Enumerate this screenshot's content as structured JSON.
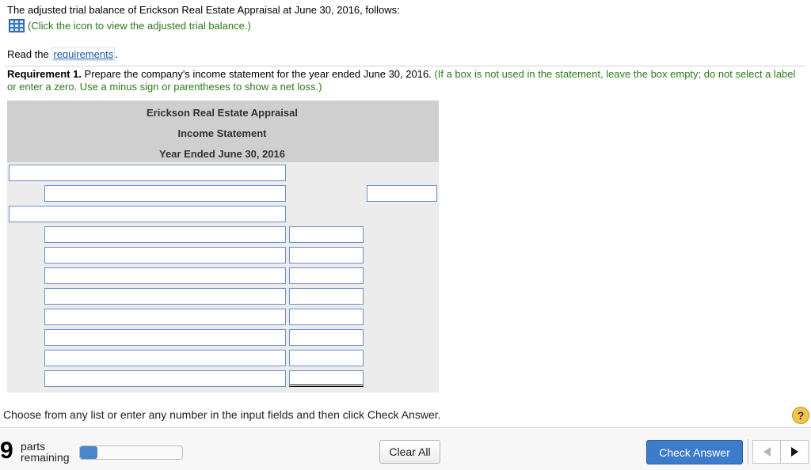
{
  "intro": "The adjusted trial balance of Erickson Real Estate Appraisal at June 30, 2016, follows:",
  "icon_link": "(Click the icon to view the adjusted trial balance.)",
  "read_prefix": "Read the ",
  "requirements_link": "requirements",
  "read_suffix": ".",
  "requirement": {
    "label": "Requirement 1.",
    "text": " Prepare the company's income statement for the year ended June 30, 2016. ",
    "instruction": "(If a box is not used in the statement, leave the box empty; do not select a label or enter a zero. Use a minus sign or parentheses to show a net loss.)"
  },
  "statement": {
    "company": "Erickson Real Estate Appraisal",
    "title": "Income Statement",
    "period": "Year Ended June 30, 2016"
  },
  "choose_text": "Choose from any list or enter any number in the input fields and then click Check Answer.",
  "help": "?",
  "footer": {
    "parts_count": "9",
    "parts_line1": "parts",
    "parts_line2": "remaining",
    "progress_fraction": 0.17,
    "clear_label": "Clear All",
    "check_label": "Check Answer"
  }
}
